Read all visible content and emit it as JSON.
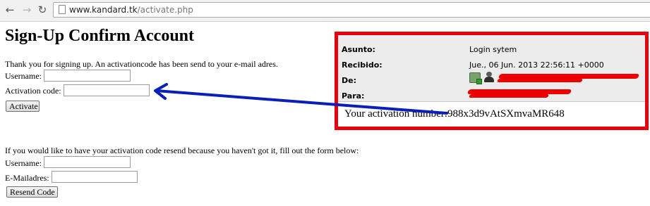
{
  "browser": {
    "url_host": "www.kandard.tk",
    "url_path": "/activate.php"
  },
  "page": {
    "title": "Sign-Up Confirm Account",
    "intro": "Thank you for signing up. An activationcode has been send to your e-mail adres.",
    "activate_form": {
      "username_label": "Username:",
      "username_value": "",
      "code_label": "Activation code:",
      "code_value": "",
      "button": "Activate"
    },
    "resend_text": "If you would like to have your activation code resend because you haven't got it, fill out the form below:",
    "resend_form": {
      "username_label": "Username:",
      "username_value": "",
      "email_label": "E-Mailadres:",
      "email_value": "",
      "button": "Resend Code"
    }
  },
  "email": {
    "subject_label": "Asunto:",
    "subject_value": "Login sytem",
    "received_label": "Recibido:",
    "received_value": "Jue., 06 Jun. 2013 22:56:11 +0000",
    "from_label": "De:",
    "to_label": "Para:",
    "body_prefix": "Your activation number:",
    "activation_code": "988x3d9vAtSXmvaMR648"
  },
  "annotation": {
    "border_color": "#e8000d",
    "arrow_color": "#0a1fb5",
    "redaction_color": "#ee0000"
  }
}
